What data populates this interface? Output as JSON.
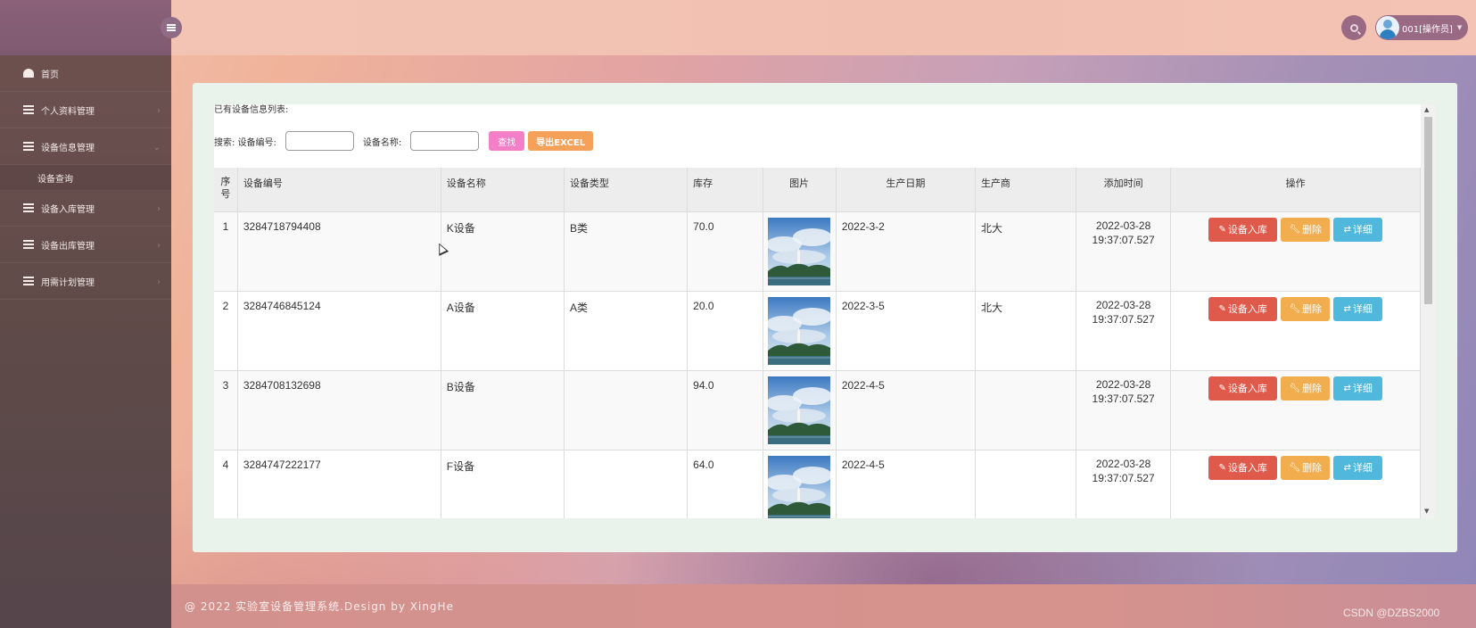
{
  "sidebar": {
    "items": [
      {
        "label": "首页",
        "icon": "dashboard-icon"
      },
      {
        "label": "个人资料管理",
        "icon": "list-icon"
      },
      {
        "label": "设备信息管理",
        "icon": "list-icon",
        "expanded": true,
        "children": [
          {
            "label": "设备查询"
          }
        ]
      },
      {
        "label": "设备入库管理",
        "icon": "list-icon"
      },
      {
        "label": "设备出库管理",
        "icon": "list-icon"
      },
      {
        "label": "用需计划管理",
        "icon": "list-icon"
      }
    ]
  },
  "header": {
    "user_label": "001[操作员]"
  },
  "main": {
    "list_title": "已有设备信息列表:",
    "search_prefix": "搜索: 设备编号:",
    "name_label": "设备名称:",
    "device_no_value": "",
    "device_name_value": "",
    "find_button": "查找",
    "export_button": "导出EXCEL"
  },
  "table": {
    "headers": {
      "seq": "序号",
      "device_no": "设备编号",
      "device_name": "设备名称",
      "device_type": "设备类型",
      "stock": "库存",
      "image": "图片",
      "production_date": "生产日期",
      "manufacturer": "生产商",
      "added_time": "添加时间",
      "actions": "操作"
    },
    "rows": [
      {
        "seq": "1",
        "device_no": "3284718794408",
        "device_name": "K设备",
        "device_type": "B类",
        "stock": "70.0",
        "production_date": "2022-3-2",
        "manufacturer": "北大",
        "added_date": "2022-03-28",
        "added_clock": "19:37:07.527"
      },
      {
        "seq": "2",
        "device_no": "3284746845124",
        "device_name": "A设备",
        "device_type": "A类",
        "stock": "20.0",
        "production_date": "2022-3-5",
        "manufacturer": "北大",
        "added_date": "2022-03-28",
        "added_clock": "19:37:07.527"
      },
      {
        "seq": "3",
        "device_no": "3284708132698",
        "device_name": "B设备",
        "device_type": "",
        "stock": "94.0",
        "production_date": "2022-4-5",
        "manufacturer": "",
        "added_date": "2022-03-28",
        "added_clock": "19:37:07.527"
      },
      {
        "seq": "4",
        "device_no": "3284747222177",
        "device_name": "F设备",
        "device_type": "",
        "stock": "64.0",
        "production_date": "2022-4-5",
        "manufacturer": "",
        "added_date": "2022-03-28",
        "added_clock": "19:37:07.527"
      }
    ],
    "action_labels": {
      "stock_in": "设备入库",
      "delete": "删除",
      "detail": "详细"
    }
  },
  "footer": {
    "text": "@ 2022 实验室设备管理系统.Design by XingHe",
    "watermark": "CSDN @DZBS2000"
  },
  "colors": {
    "stock_in": "#e05a4b",
    "delete": "#f1ad4e",
    "detail": "#50b8dd",
    "find": "#f27fc7",
    "export": "#f6a15a"
  }
}
